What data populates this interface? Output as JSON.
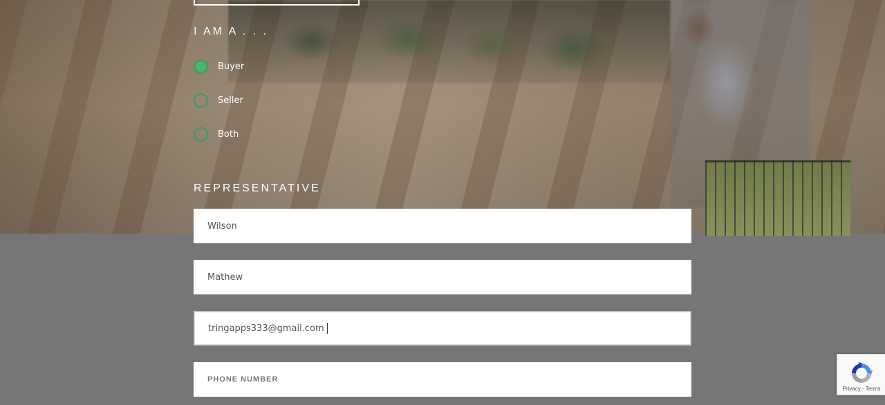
{
  "form": {
    "iam_label": "I AM A . . .",
    "role_options": [
      {
        "label": "Buyer",
        "checked": true
      },
      {
        "label": "Seller",
        "checked": false
      },
      {
        "label": "Both",
        "checked": false
      }
    ],
    "representative_label": "REPRESENTATIVE",
    "last_name_value": "Wilson",
    "first_name_value": "Mathew",
    "email_value": "tringapps333@gmail.com",
    "phone_placeholder": "PHONE NUMBER"
  },
  "recaptcha": {
    "icon": "recaptcha-logo-icon",
    "terms_text": "Privacy - Terms"
  },
  "colors": {
    "accent_green": "#3fbf6a",
    "page_bg": "#767676"
  }
}
